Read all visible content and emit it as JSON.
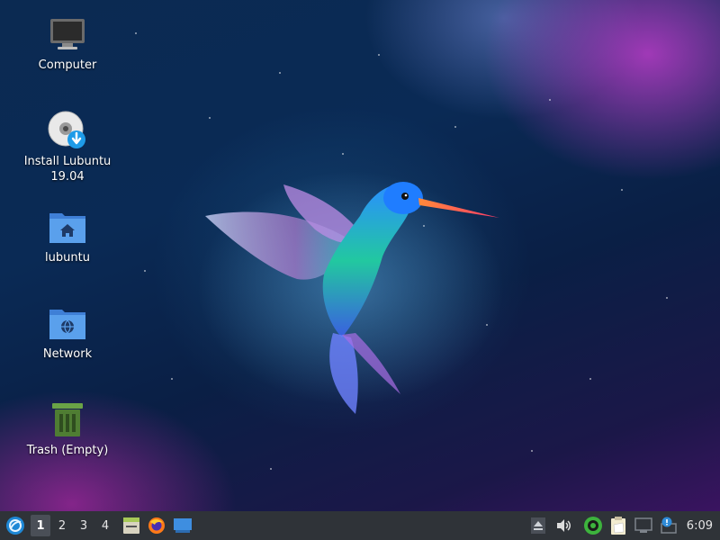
{
  "desktop": {
    "icons": [
      {
        "label": "Computer",
        "icon": "monitor-icon"
      },
      {
        "label": "Install Lubuntu\n19.04",
        "icon": "install-disc-icon"
      },
      {
        "label": "lubuntu",
        "icon": "home-folder-icon"
      },
      {
        "label": "Network",
        "icon": "network-folder-icon"
      },
      {
        "label": "Trash (Empty)",
        "icon": "trash-icon"
      }
    ],
    "wallpaper": "hummingbird"
  },
  "taskbar": {
    "workspaces": [
      "1",
      "2",
      "3",
      "4"
    ],
    "active_workspace": "1",
    "launchers": [
      "file-manager-icon",
      "firefox-icon",
      "show-desktop-icon"
    ],
    "tray": [
      "eject-icon",
      "volume-icon",
      "update-status-icon",
      "clipboard-icon",
      "network-monitor-icon",
      "notification-icon"
    ],
    "clock": "6:09"
  },
  "colors": {
    "taskbar": "#2f3338",
    "folder": "#4a90e2",
    "trash": "#5a8a3a"
  }
}
